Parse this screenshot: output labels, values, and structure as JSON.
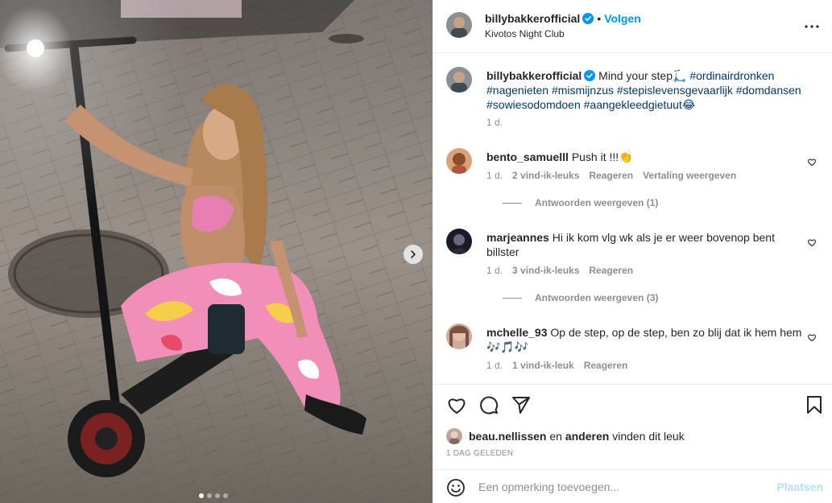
{
  "post": {
    "author": "billybakkerofficial",
    "follow_label": "Volgen",
    "bullet": "•",
    "location": "Kivotos Night Club",
    "more_icon": "more-horizontal-icon",
    "caption": {
      "text": "Mind your step🛴",
      "hashtags": [
        "#ordinairdronken",
        "#nagenieten",
        "#mismijnzus",
        "#stepislevensgevaarlijk",
        "#domdansen",
        "#sowiesodomdoen",
        "#aangekleedgietuut😂"
      ],
      "time": "1 d."
    },
    "carousel": {
      "total": 4,
      "active": 0
    },
    "verified_color": "#0095f6"
  },
  "comments": [
    {
      "user": "bento_samuelll",
      "text": "Push it !!!👏",
      "time": "1 d.",
      "likes": "2 vind-ik-leuks",
      "reply": "Reageren",
      "translate": "Vertaling weergeven",
      "view_replies": "Antwoorden weergeven (1)"
    },
    {
      "user": "marjeannes",
      "text": "Hi ik kom vlg wk als je er weer bovenop bent billster",
      "time": "1 d.",
      "likes": "3 vind-ik-leuks",
      "reply": "Reageren",
      "view_replies": "Antwoorden weergeven (3)"
    },
    {
      "user": "mchelle_93",
      "text": "Op de step, op de step, ben zo blij dat ik hem hem 🎶🎵🎶",
      "time": "1 d.",
      "likes": "1 vind-ik-leuk",
      "reply": "Reageren"
    }
  ],
  "actions": {
    "like_icon": "heart-icon",
    "comment_icon": "comment-icon",
    "share_icon": "send-icon",
    "save_icon": "bookmark-icon"
  },
  "likes": {
    "user": "beau.nellissen",
    "and": "en",
    "others": "anderen",
    "suffix": "vinden dit leuk"
  },
  "date": "1 DAG GELEDEN",
  "add_comment": {
    "placeholder": "Een opmerking toevoegen...",
    "post_label": "Plaatsen"
  }
}
